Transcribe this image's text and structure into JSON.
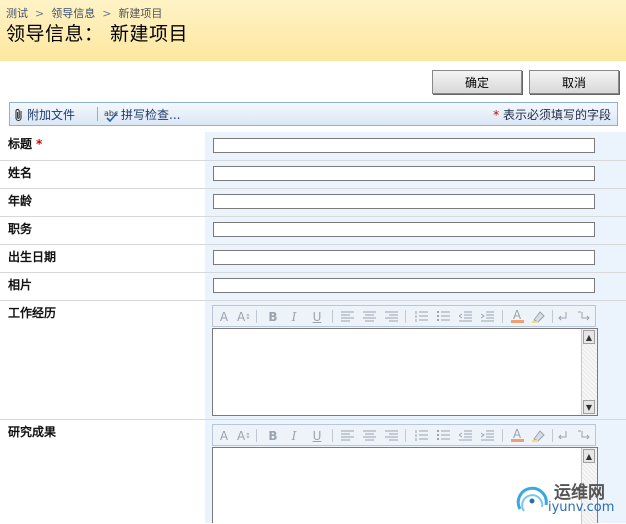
{
  "breadcrumb": {
    "items": [
      "测试",
      "领导信息"
    ],
    "separator": ">",
    "current": "新建项目"
  },
  "page_title": "领导信息： 新建项目",
  "buttons": {
    "ok": "确定",
    "cancel": "取消"
  },
  "toolbar": {
    "attach": "附加文件",
    "spellcheck": "拼写检查...",
    "required_star": "*",
    "required_note": "表示必须填写的字段"
  },
  "fields": [
    {
      "label": "标题",
      "required": "*",
      "value": ""
    },
    {
      "label": "姓名",
      "value": ""
    },
    {
      "label": "年龄",
      "value": ""
    },
    {
      "label": "职务",
      "value": ""
    },
    {
      "label": "出生日期",
      "value": ""
    },
    {
      "label": "相片",
      "value": ""
    },
    {
      "label": "工作经历",
      "type": "richtext"
    },
    {
      "label": "研究成果",
      "type": "richtext"
    }
  ],
  "rte_toolbar": [
    "font-icon",
    "font-size-icon",
    "bold-icon",
    "italic-icon",
    "underline-icon",
    "align-left-icon",
    "align-center-icon",
    "align-right-icon",
    "numbered-list-icon",
    "bullet-list-icon",
    "decrease-indent-icon",
    "increase-indent-icon",
    "text-color-icon",
    "highlight-icon",
    "ltr-icon",
    "rtl-icon"
  ],
  "rte_labels": {
    "font": "A",
    "font_size": "A",
    "bold": "B",
    "italic": "I",
    "underline": "U",
    "text_color": "A"
  },
  "watermark": {
    "line1": "运维网",
    "line2": "iyunv.com"
  },
  "colors": {
    "header_bg": "#fde79f",
    "toolbar_bg": "#dbe7f5",
    "panel_bg": "#ebf3fc",
    "required": "#cc0000"
  }
}
